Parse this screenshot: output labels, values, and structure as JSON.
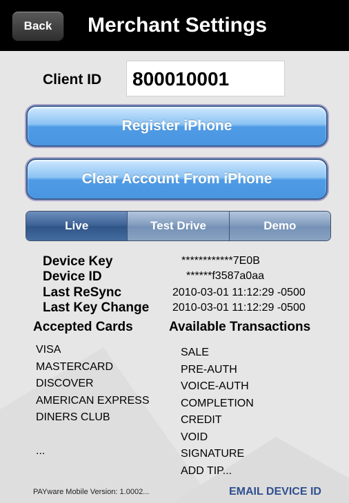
{
  "navbar": {
    "back_label": "Back",
    "title": "Merchant Settings"
  },
  "client": {
    "label": "Client ID",
    "value": "800010001"
  },
  "buttons": {
    "register": "Register iPhone",
    "clear": "Clear Account From iPhone"
  },
  "mode_segments": [
    {
      "label": "Live",
      "selected": true
    },
    {
      "label": "Test Drive",
      "selected": false
    },
    {
      "label": "Demo",
      "selected": false
    }
  ],
  "device_info": {
    "device_key_label": "Device Key",
    "device_key_value": "************7E0B",
    "device_id_label": "Device ID",
    "device_id_value": "******f3587a0aa",
    "last_resync_label": "Last ReSync",
    "last_resync_value": "2010-03-01 11:12:29 -0500",
    "last_key_change_label": "Last Key Change",
    "last_key_change_value": "2010-03-01 11:12:29 -0500"
  },
  "accepted_cards": {
    "heading": "Accepted Cards",
    "items": [
      "VISA",
      "MASTERCARD",
      "DISCOVER",
      "AMERICAN EXPRESS",
      "DINERS CLUB",
      "",
      "..."
    ]
  },
  "available_transactions": {
    "heading": "Available Transactions",
    "items": [
      "SALE",
      "PRE-AUTH",
      "VOICE-AUTH",
      "COMPLETION",
      "CREDIT",
      "VOID",
      "SIGNATURE",
      "ADD TIP..."
    ]
  },
  "footer": {
    "version": "PAYware Mobile Version: 1.0002...",
    "email_link": "EMAIL DEVICE ID"
  },
  "colors": {
    "navbar": "#000000",
    "button_blue": "#4a95e0",
    "segment_selected": "#3b5f92",
    "link": "#2f4f8f"
  }
}
